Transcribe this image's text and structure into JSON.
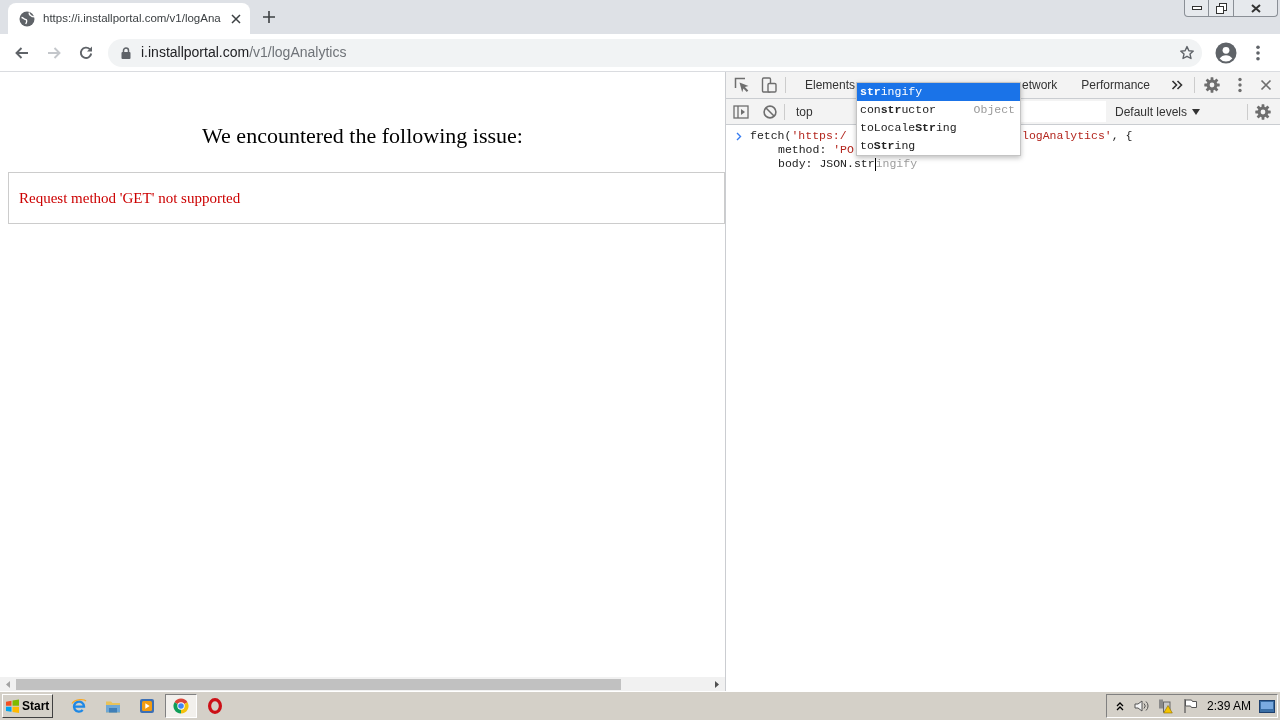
{
  "browser": {
    "tab": {
      "title": "https://i.installportal.com/v1/logAna"
    },
    "nav_buttons": [
      {
        "kind": "back",
        "disabled": false
      },
      {
        "kind": "forward",
        "disabled": true
      },
      {
        "kind": "reload",
        "disabled": false
      }
    ],
    "address": {
      "host": "i.installportal.com",
      "path": "/v1/logAnalytics"
    }
  },
  "page": {
    "heading": "We encountered the following issue:",
    "error": "Request method 'GET' not supported"
  },
  "devtools": {
    "tabs": [
      {
        "label": "Elements",
        "selected": false
      },
      {
        "label": "etwork",
        "selected": false
      },
      {
        "label": "Performance",
        "selected": false
      }
    ],
    "context": "top",
    "levels": "Default levels",
    "console": {
      "lines": [
        {
          "indented": false,
          "head": [
            {
              "kind": "plain",
              "text": "fetch("
            },
            {
              "kind": "string",
              "text": "'https:/"
            }
          ],
          "tail": [
            {
              "kind": "string",
              "text": "logAnalytics'"
            },
            {
              "kind": "plain",
              "text": ", {"
            }
          ]
        },
        {
          "indented": true,
          "head": [
            {
              "kind": "plain",
              "text": "method: "
            },
            {
              "kind": "string",
              "text": "'PO"
            }
          ]
        },
        {
          "indented": true,
          "head": [
            {
              "kind": "plain",
              "text": "body: JSON.str"
            },
            {
              "kind": "cursor"
            },
            {
              "kind": "ghost",
              "text": "ingify"
            }
          ]
        }
      ]
    },
    "autocomplete": {
      "items": [
        {
          "label": "**str**ingify",
          "selected": true
        },
        {
          "label": "con**str**uctor",
          "type": "Object",
          "selected": false
        },
        {
          "label": "toLocale**Str**ing",
          "selected": false
        },
        {
          "label": "to**Str**ing",
          "selected": false
        }
      ]
    }
  },
  "taskbar": {
    "start": "Start",
    "apps": [
      {
        "kind": "e_logo",
        "selected": false
      },
      {
        "kind": "folder",
        "selected": false
      },
      {
        "kind": "player",
        "selected": false
      },
      {
        "kind": "round_logo",
        "selected": true
      },
      {
        "kind": "o_logo",
        "selected": false
      }
    ],
    "clock": "2:39 AM"
  }
}
